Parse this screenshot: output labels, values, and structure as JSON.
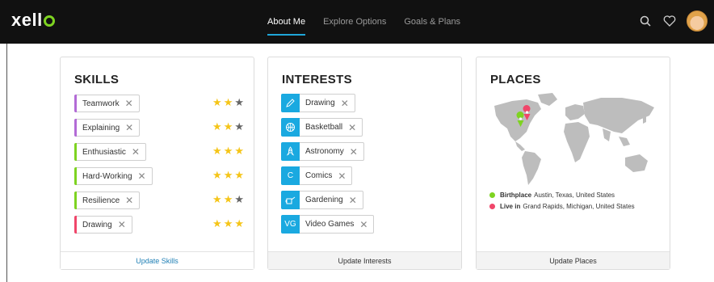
{
  "brand": {
    "logo": "xello",
    "accent": "#7ed321"
  },
  "nav": {
    "links": [
      "About Me",
      "Explore Options",
      "Goals & Plans"
    ],
    "active_index": 0,
    "icons": [
      "search-icon",
      "heart-icon",
      "avatar"
    ]
  },
  "skills": {
    "title": "SKILLS",
    "footer": "Update Skills",
    "items": [
      {
        "label": "Teamwork",
        "color": "#b36bd6",
        "rating": 2,
        "max": 3
      },
      {
        "label": "Explaining",
        "color": "#b36bd6",
        "rating": 2,
        "max": 3
      },
      {
        "label": "Enthusiastic",
        "color": "#7ed321",
        "rating": 3,
        "max": 3
      },
      {
        "label": "Hard-Working",
        "color": "#7ed321",
        "rating": 3,
        "max": 3
      },
      {
        "label": "Resilience",
        "color": "#7ed321",
        "rating": 2,
        "max": 3
      },
      {
        "label": "Drawing",
        "color": "#f0466a",
        "rating": 3,
        "max": 3
      }
    ]
  },
  "interests": {
    "title": "INTERESTS",
    "footer": "Update Interests",
    "items": [
      {
        "label": "Drawing",
        "icon": "pencil-icon"
      },
      {
        "label": "Basketball",
        "icon": "basketball-icon"
      },
      {
        "label": "Astronomy",
        "icon": "rocket-icon"
      },
      {
        "label": "Comics",
        "icon_text": "C"
      },
      {
        "label": "Gardening",
        "icon": "watering-can-icon"
      },
      {
        "label": "Video Games",
        "icon_text": "VG"
      }
    ]
  },
  "places": {
    "title": "PLACES",
    "footer": "Update Places",
    "legend": [
      {
        "label": "Birthplace",
        "value": "Austin, Texas, United States",
        "color": "#7ed321"
      },
      {
        "label": "Live in",
        "value": "Grand Rapids, Michigan, United States",
        "color": "#f0466a"
      }
    ]
  },
  "colors": {
    "star_on": "#f5c518",
    "star_off": "#666666",
    "interest_icon_bg": "#1aa9e0",
    "link": "#1f7fb5"
  }
}
